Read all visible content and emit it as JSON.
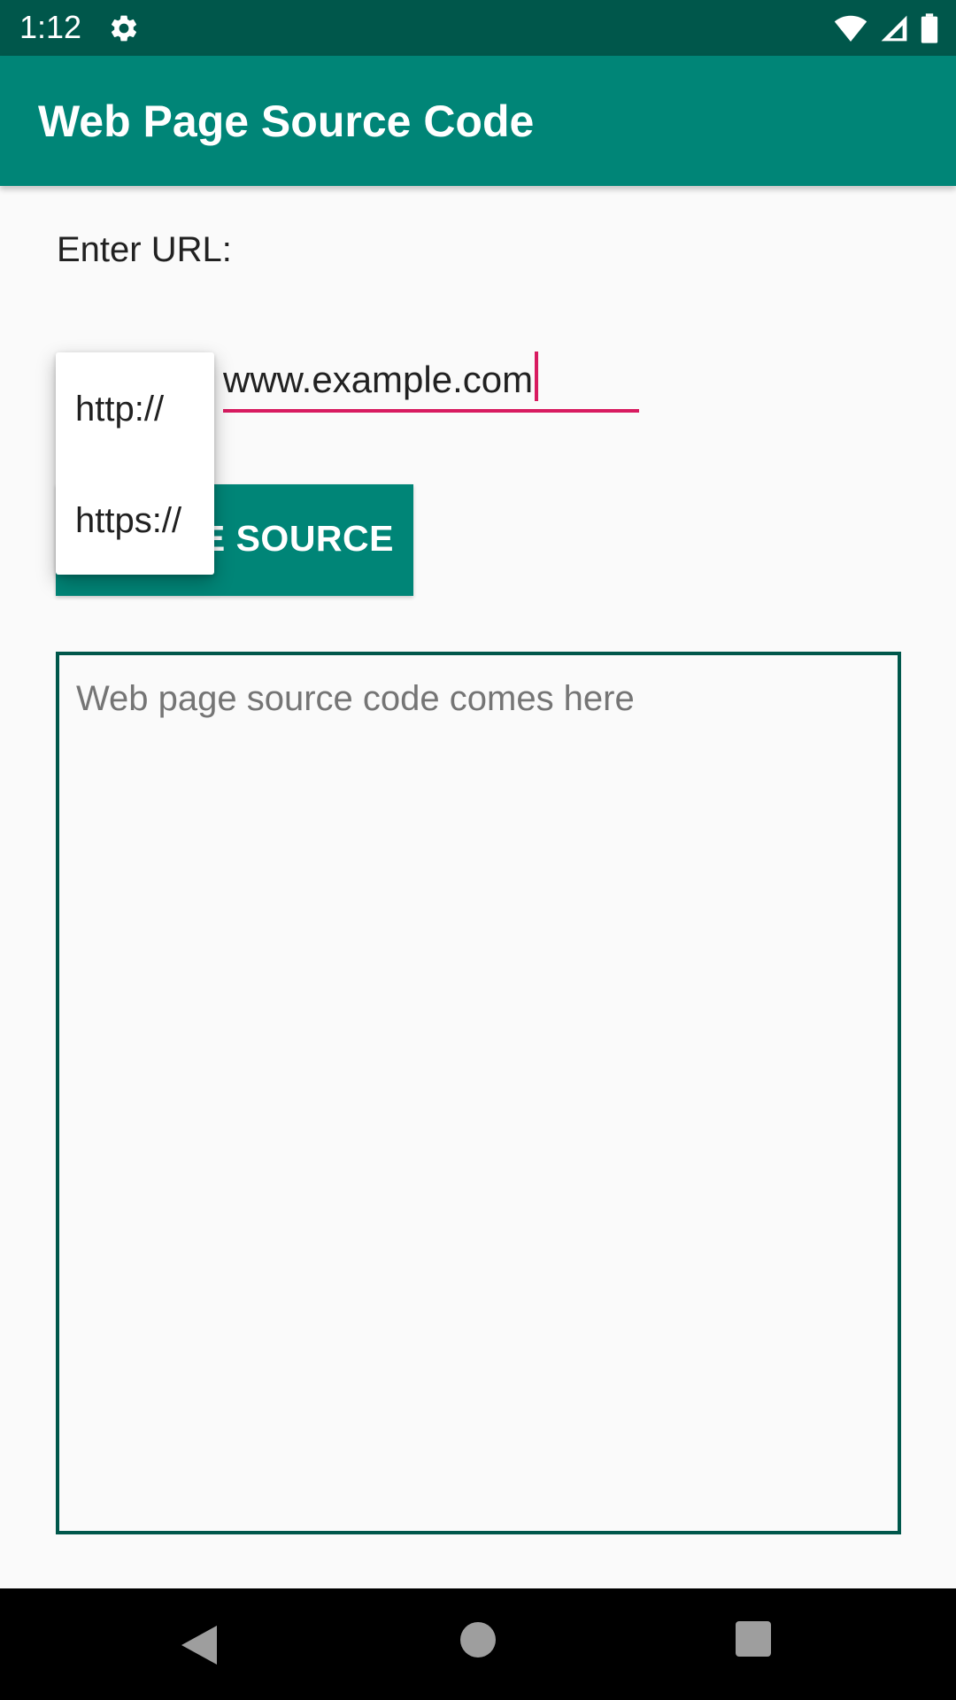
{
  "status_bar": {
    "time": "1:12",
    "icons": [
      "gear-icon",
      "wifi-icon",
      "signal-icon",
      "battery-icon"
    ],
    "background": "#00574b"
  },
  "app_bar": {
    "title": "Web Page Source Code",
    "background": "#008577"
  },
  "form": {
    "enter_url_label": "Enter URL:",
    "url_value": "www.example.com",
    "protocol_options": [
      "http://",
      "https://"
    ],
    "button_visible_label": "GE SOURCE",
    "source_placeholder": "Web page source code comes here",
    "accent_color": "#d81b60"
  },
  "nav_bar": {
    "icons": [
      "back-icon",
      "home-icon",
      "recents-icon"
    ]
  }
}
